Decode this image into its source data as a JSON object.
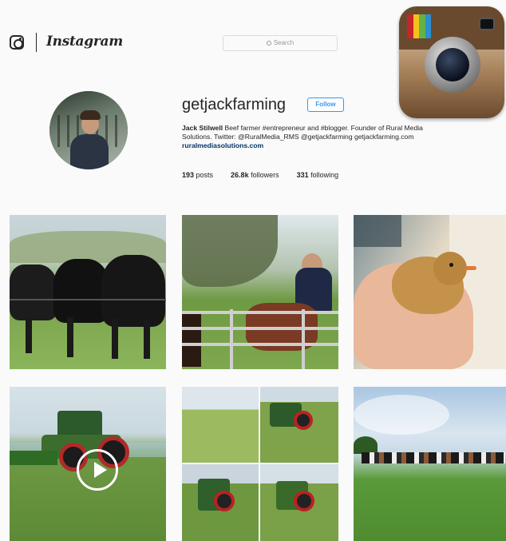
{
  "header": {
    "brand": "Instagram",
    "search_placeholder": "Search"
  },
  "profile": {
    "username": "getjackfarming",
    "follow_label": "Follow",
    "bio_name": "Jack Stilwell",
    "bio_line1": " Beef farmer #entrepreneur and #blogger. Founder of Rural Media",
    "bio_line2": "Solutions. Twitter: @RuralMedia_RMS @getjackfarming getjackfarming.com",
    "bio_link": "ruralmediasolutions.com",
    "posts_count": "193",
    "posts_label": " posts",
    "followers_count": "26.8k",
    "followers_label": " followers",
    "following_count": "331",
    "following_label": " following"
  },
  "posts": [
    {
      "kind": "photo",
      "subject": "black cattle at a fence"
    },
    {
      "kind": "photo",
      "subject": "farmer at a gate with cattle"
    },
    {
      "kind": "photo",
      "subject": "chick held in a hand"
    },
    {
      "kind": "video",
      "subject": "tractor mowing grass"
    },
    {
      "kind": "photo",
      "subject": "tractor collage"
    },
    {
      "kind": "photo",
      "subject": "cattle herd in a field"
    }
  ],
  "colors": {
    "link_blue": "#3897f0",
    "bio_link": "#003569",
    "background": "#fafafa"
  }
}
